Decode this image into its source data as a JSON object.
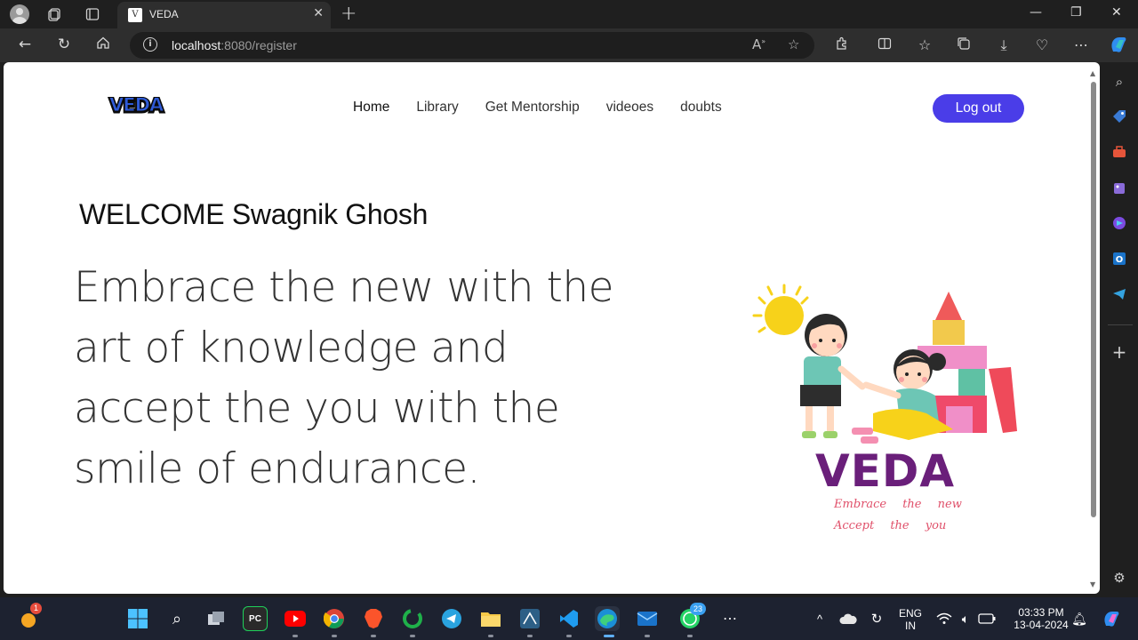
{
  "browser": {
    "tab_title": "VEDA",
    "tab_favicon": "V",
    "url_host": "localhost",
    "url_rest": ":8080/register"
  },
  "page": {
    "nav": [
      "Home",
      "Library",
      "Get Mentorship",
      "videoes",
      "doubts"
    ],
    "logout_label": "Log out",
    "welcome": "WELCOME Swagnik Ghosh",
    "headline": "Embrace the new with the art of knowledge and accept the you with the smile of endurance.",
    "logo_text": "VEDA",
    "illustration": {
      "brand": "VEDA",
      "tagline_1": "Embrace the new",
      "tagline_2": "Accept the you"
    }
  },
  "taskbar": {
    "weather_badge": "1",
    "whatsapp_badge": "23",
    "language_1": "ENG",
    "language_2": "IN",
    "time": "03:33 PM",
    "date": "13-04-2024"
  },
  "colors": {
    "accent": "#4a3de8",
    "brand_purple": "#6a1f7a"
  }
}
